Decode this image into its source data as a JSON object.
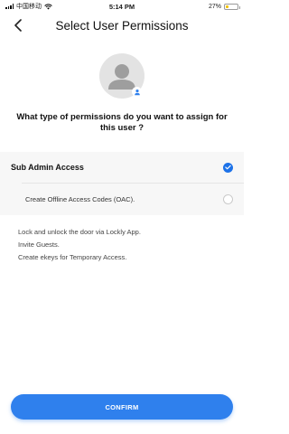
{
  "status_bar": {
    "carrier": "中国移动",
    "time": "5:14 PM",
    "battery_percent": "27%",
    "battery_level": 0.27,
    "icons": [
      "signal-icon",
      "wifi-icon",
      "battery-icon"
    ]
  },
  "nav": {
    "title": "Select User Permissions",
    "back_icon": "chevron-left-icon"
  },
  "avatar": {
    "icon": "user-avatar-icon",
    "badge_icon": "user-badge-icon"
  },
  "question": "What type of permissions do you want to assign for this user ?",
  "options": [
    {
      "label": "Sub Admin Access",
      "selected": true
    },
    {
      "label": "Create Offline Access Codes (OAC).",
      "selected": false
    }
  ],
  "description": [
    "Lock and unlock the door via Lockly App.",
    "Invite Guests.",
    "Create ekeys for Temporary Access."
  ],
  "confirm_label": "CONFIRM",
  "colors": {
    "accent": "#2f80ed",
    "radio_checked": "#1d72e8",
    "battery": "#f2c200"
  }
}
